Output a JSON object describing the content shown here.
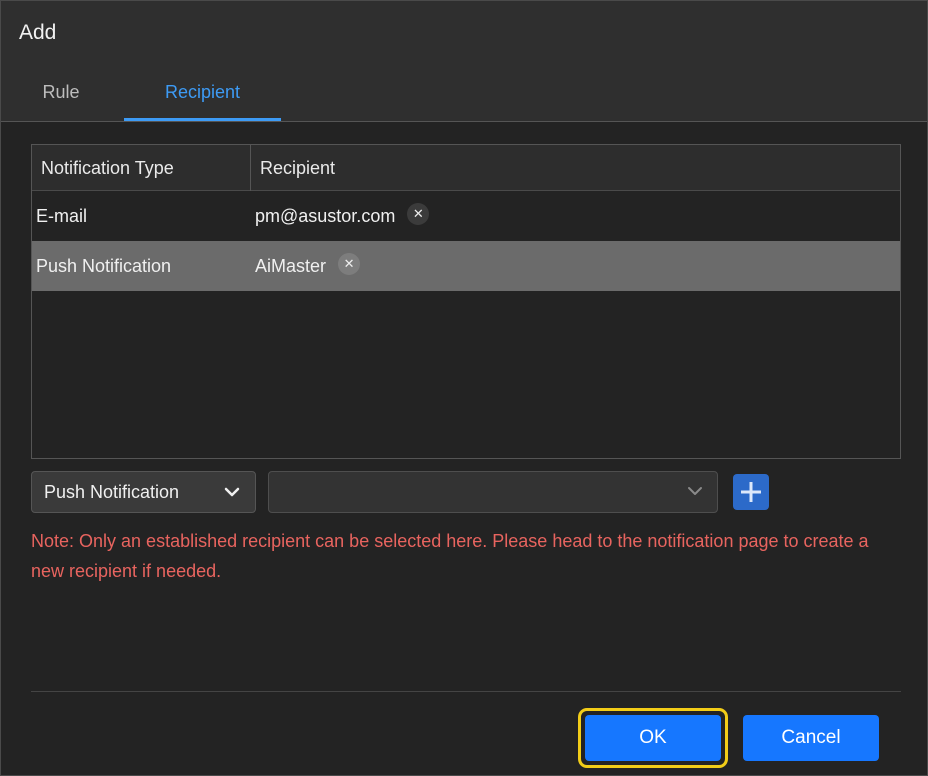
{
  "dialog": {
    "title": "Add",
    "tabs": [
      {
        "label": "Rule",
        "active": false
      },
      {
        "label": "Recipient",
        "active": true
      }
    ]
  },
  "table": {
    "columns": [
      "Notification Type",
      "Recipient"
    ],
    "rows": [
      {
        "type": "E-mail",
        "recipient": "pm@asustor.com",
        "selected": false
      },
      {
        "type": "Push Notification",
        "recipient": "AiMaster",
        "selected": true
      }
    ]
  },
  "form": {
    "type_select_value": "Push Notification",
    "recipient_select_value": "",
    "add_icon": "plus-icon"
  },
  "note": "Note: Only an established recipient can be selected here. Please head to the notification page to create a new recipient if needed.",
  "buttons": {
    "ok": "OK",
    "cancel": "Cancel"
  },
  "colors": {
    "accent": "#1677ff",
    "tab_active": "#3d9bf5",
    "note": "#e8645f",
    "focus_ring": "#f2cd18"
  }
}
